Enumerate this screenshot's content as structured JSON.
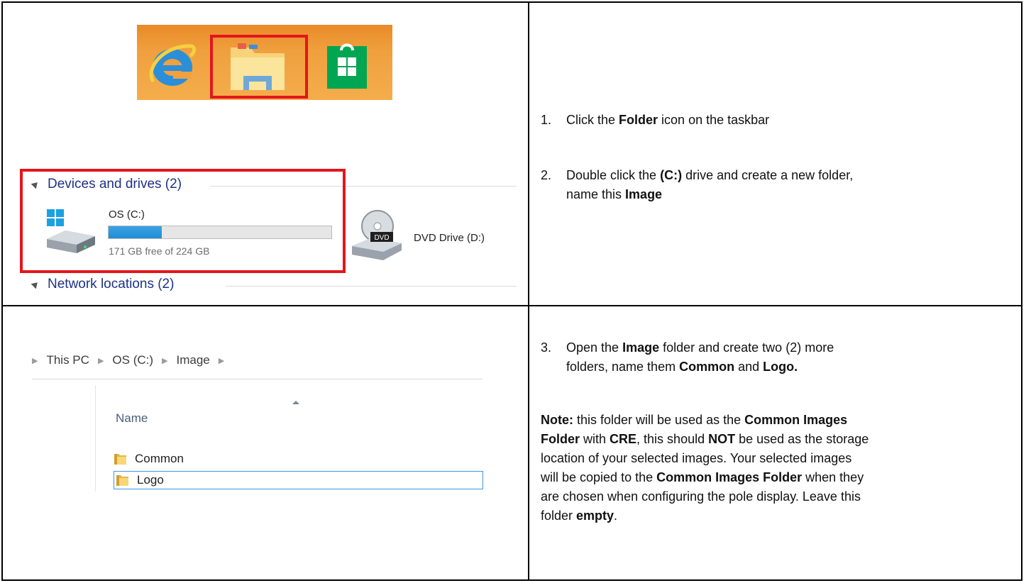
{
  "taskbar": {
    "icons": [
      "internet-explorer-icon",
      "file-explorer-folder-icon",
      "store-icon"
    ]
  },
  "drives": {
    "devices_header": "Devices and drives (2)",
    "os_drive": {
      "label": "OS (C:)",
      "free_text": "171 GB free of 224 GB",
      "used_fraction": 0.24
    },
    "dvd_drive": {
      "label": "DVD Drive (D:)",
      "badge": "DVD"
    },
    "network_header": "Network locations (2)"
  },
  "steps_top": {
    "step1": {
      "num": "1.",
      "pre": "Click the ",
      "bold": "Folder",
      "post": " icon on the taskbar"
    },
    "step2": {
      "num": "2.",
      "pre": "Double click the ",
      "bold1": "(C:)",
      "mid": " drive and create a new folder,",
      "line2_pre": "name this ",
      "bold2": "Image"
    }
  },
  "explorer": {
    "breadcrumb": [
      "This PC",
      "OS (C:)",
      "Image"
    ],
    "name_column": "Name",
    "items": [
      "Common",
      "Logo"
    ]
  },
  "steps_bottom": {
    "step3": {
      "num": "3.",
      "l1_pre": "Open the ",
      "l1_bold": "Image",
      "l1_post": " folder and create two (2) more",
      "l2_pre": "folders, name them ",
      "l2_bold1": "Common",
      "l2_mid": " and ",
      "l2_bold2": "Logo."
    },
    "note": {
      "b1": "Note:",
      "t1": " this folder will be used as the ",
      "b2": "Common Images",
      "b3": "Folder",
      "t2": " with ",
      "b4": "CRE",
      "t3": ", this should ",
      "b5": "NOT",
      "t4": " be used as the storage",
      "t5": "location of your selected images. Your selected images",
      "t6": "will be copied to the ",
      "b6": "Common Images Folder",
      "t7": " when they",
      "t8": "are chosen when configuring the pole display. Leave this",
      "t9": "folder ",
      "b7": "empty",
      "t10": "."
    }
  },
  "colors": {
    "highlight_red": "#e3161c",
    "taskbar_orange": "#f0a03e",
    "header_blue": "#1e3287",
    "usage_blue": "#1f8dd6"
  }
}
